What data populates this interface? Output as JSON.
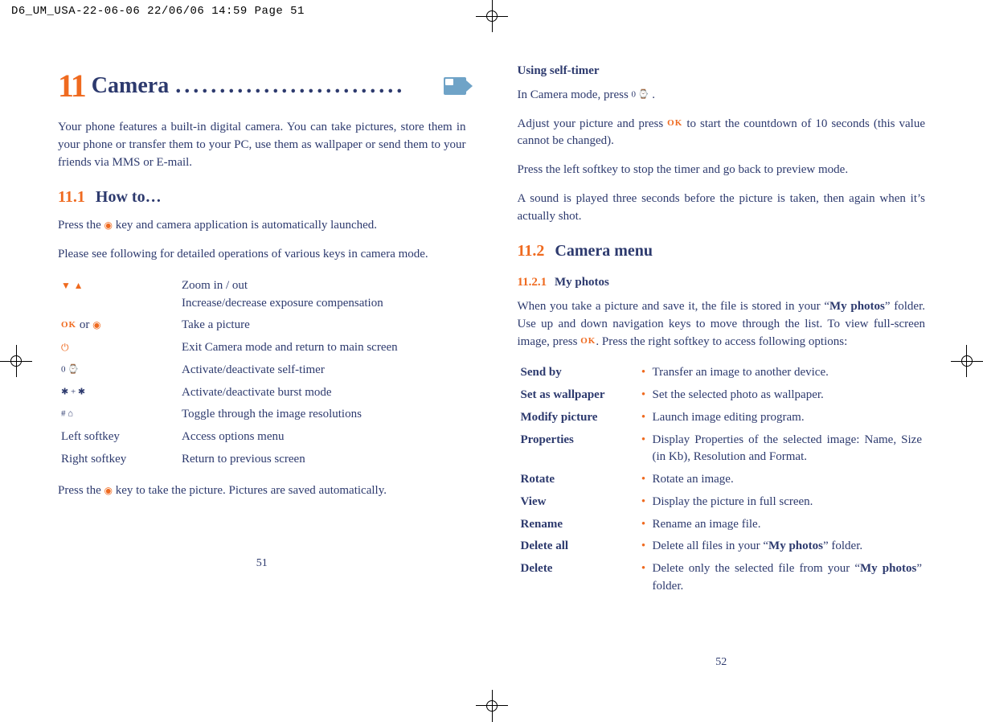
{
  "header_line": "D6_UM_USA-22-06-06  22/06/06  14:59  Page 51",
  "left": {
    "chapter_number": "11",
    "chapter_title": "Camera",
    "intro": "Your phone features a built-in digital camera. You can take pictures, store them in your phone or transfer them to your PC, use them as wallpaper or send them to your friends via MMS or E-mail.",
    "section_num": "11.1",
    "section_title": "How to…",
    "p1_before": "Press the ",
    "p1_after": " key and camera application is automatically launched.",
    "p2": "Please see following for detailed operations of various keys in camera mode.",
    "keytable": [
      {
        "key_icon": "nav-arrows",
        "desc": "Zoom in / out\nIncrease/decrease exposure compensation"
      },
      {
        "key_icon": "ok-or-cam",
        "desc": "Take a picture"
      },
      {
        "key_icon": "end-key",
        "desc": "Exit Camera mode and return to main screen"
      },
      {
        "key_icon": "zero-timer",
        "desc": "Activate/deactivate self-timer"
      },
      {
        "key_icon": "star-key",
        "desc": "Activate/deactivate burst mode"
      },
      {
        "key_icon": "hash-key",
        "desc": "Toggle through the image resolutions"
      },
      {
        "key_text": "Left softkey",
        "desc": "Access options menu"
      },
      {
        "key_text": "Right softkey",
        "desc": "Return to previous screen"
      }
    ],
    "p3_before": "Press the ",
    "p3_after": " key to take the picture. Pictures are saved automatically.",
    "pagenum": "51"
  },
  "right": {
    "timer_heading": "Using self-timer",
    "timer_p1_before": "In Camera mode, press ",
    "timer_p1_after": ".",
    "timer_p2_before": "Adjust your picture and press ",
    "timer_p2_after": " to start the countdown of 10 seconds (this value cannot be changed).",
    "timer_p3": "Press the left softkey to stop the timer and go back to preview mode.",
    "timer_p4": "A sound is played three seconds before the picture is taken, then again when it’s actually shot.",
    "section_num": "11.2",
    "section_title": "Camera menu",
    "sub_num": "11.2.1",
    "sub_title": "My photos",
    "myphotos_p_parts": {
      "a": "When you take a picture and save it, the file is stored in your “",
      "b": "My photos",
      "c": "” folder. Use up and down navigation keys to move through the list. To view full-screen image, press ",
      "d": ". Press the right softkey to access following options:"
    },
    "options": [
      {
        "name": "Send by",
        "desc": "Transfer an image to another device."
      },
      {
        "name": "Set as wallpaper",
        "desc": "Set the selected photo as wallpaper."
      },
      {
        "name": "Modify picture",
        "desc": "Launch image editing program."
      },
      {
        "name": "Properties",
        "desc": "Display Properties of the selected image: Name, Size (in Kb), Resolution and Format."
      },
      {
        "name": "Rotate",
        "desc": "Rotate an image."
      },
      {
        "name": "View",
        "desc": "Display the picture in full screen."
      },
      {
        "name": "Rename",
        "desc": "Rename an image file."
      },
      {
        "name": "Delete all",
        "desc_parts": {
          "a": "Delete all files in your “",
          "b": "My photos",
          "c": "” folder."
        }
      },
      {
        "name": "Delete",
        "desc_parts": {
          "a": "Delete only the selected file from your “",
          "b": "My photos",
          "c": "” folder."
        }
      }
    ],
    "pagenum": "52"
  },
  "labels": {
    "ok": "OK",
    "or": " or "
  }
}
